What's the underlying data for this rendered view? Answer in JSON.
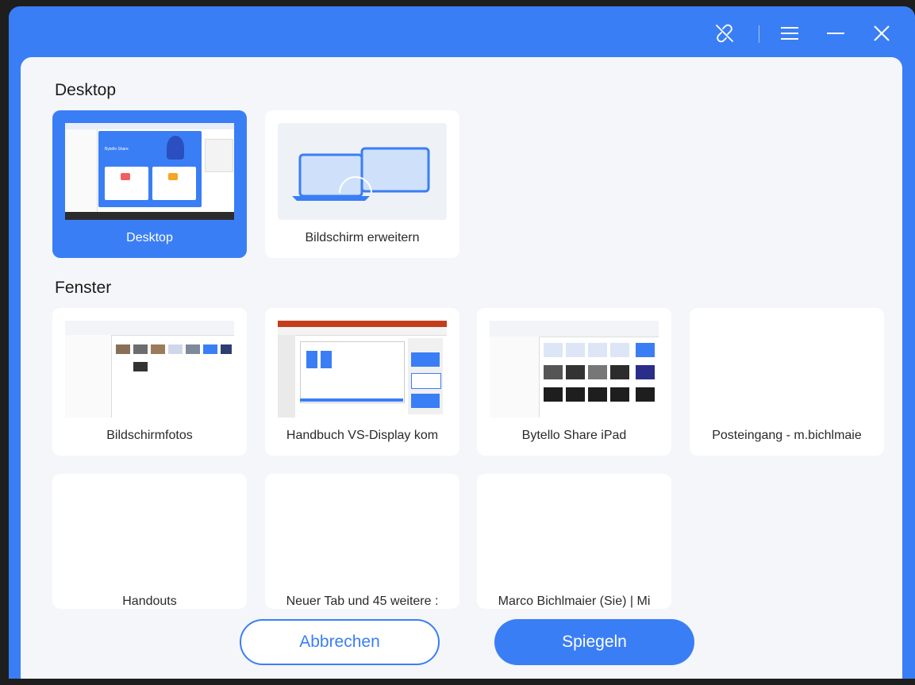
{
  "titlebar": {
    "icons": [
      "unlink-icon",
      "menu-icon",
      "minimize-icon",
      "close-icon"
    ],
    "color": "#3a7ef5"
  },
  "desktop_section": {
    "title": "Desktop",
    "cards": [
      {
        "label": "Desktop",
        "selected": true
      },
      {
        "label": "Bildschirm erweitern",
        "selected": false
      }
    ]
  },
  "window_section": {
    "title": "Fenster",
    "cards": [
      {
        "label": "Bildschirmfotos"
      },
      {
        "label": "Handbuch VS-Display kom"
      },
      {
        "label": "Bytello Share iPad"
      },
      {
        "label": "Posteingang - m.bichlmaie"
      },
      {
        "label": "Handouts"
      },
      {
        "label": "Neuer Tab und 45 weitere :"
      },
      {
        "label": "Marco Bichlmaier (Sie) | Mi"
      }
    ]
  },
  "thumbnail_text": {
    "app_name": "Bytello Share"
  },
  "buttons": {
    "cancel": "Abbrechen",
    "mirror": "Spiegeln"
  },
  "colors": {
    "accent": "#3a7ef5",
    "background": "#f5f6f9",
    "card": "#ffffff"
  }
}
